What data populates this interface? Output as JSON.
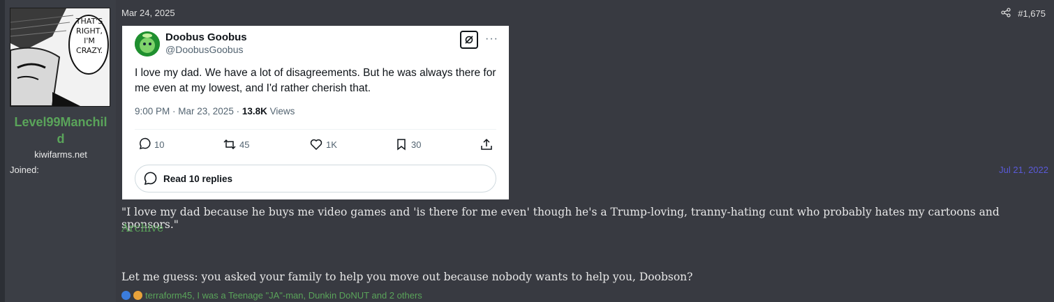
{
  "user": {
    "avatar_caption": "THAT'S RIGHT, I'M CRAZY.",
    "username_line1": "Level99Manchil",
    "username_line2": "d",
    "site": "kiwifarms.net",
    "joined_label": "Joined:",
    "joined_value": "Jul 21, 2022"
  },
  "post": {
    "date": "Mar 24, 2025",
    "number": "#1,675",
    "share_icon": "share-icon"
  },
  "tweet": {
    "display_name": "Doobus Goobus",
    "handle": "@DoobusGoobus",
    "text": "I love my dad. We have a lot of disagreements. But he was always there for me even at my lowest, and I'd rather cherish that.",
    "time": "9:00 PM · Mar 23, 2025 · ",
    "views_count": "13.8K",
    "views_label": " Views",
    "replies": "10",
    "retweets": "45",
    "likes": "1K",
    "bookmarks": "30",
    "read_replies": "Read 10 replies",
    "more": "···"
  },
  "body": {
    "quote": "\"I love my dad because he buys me video games and 'is there for me even' though he's a Trump-loving, tranny-hating cunt who probably hates my cartoons and sponsors.\"",
    "archive": "Archive",
    "guess": "Let me guess: you asked your family to help you move out because nobody wants to help you, Doobson?"
  },
  "reactions": {
    "text": "terraform45, I was a Teenage \"JA\"-man, Dunkin DoNUT and 2 others"
  },
  "colors": {
    "username": "#5aa45a",
    "link": "#5aa45a",
    "joined_date": "#5a5ad8",
    "background": "#383a41"
  }
}
